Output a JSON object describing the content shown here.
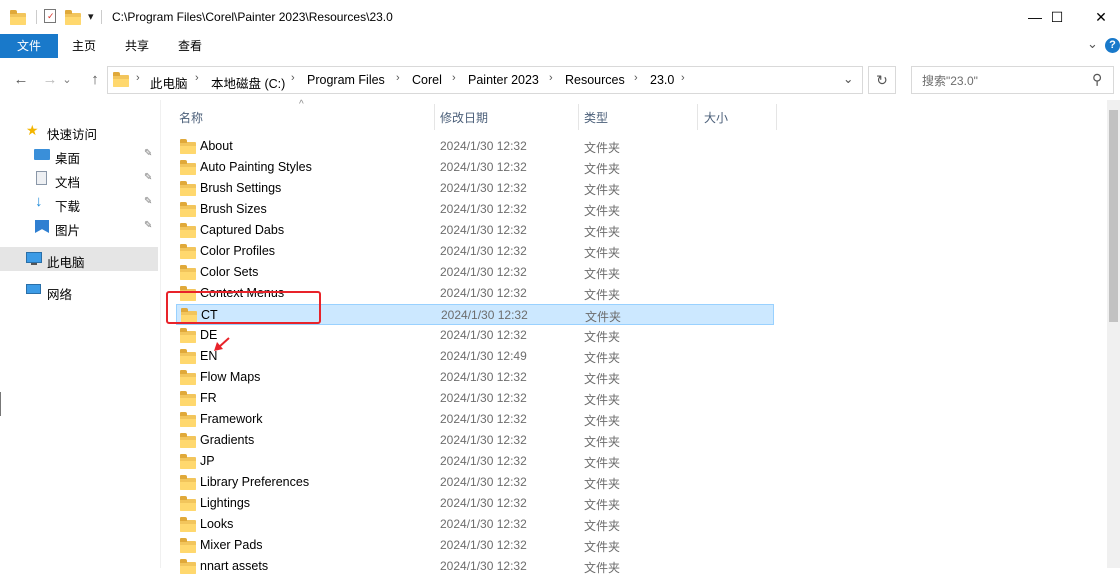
{
  "window": {
    "title_path": "C:\\Program Files\\Corel\\Painter 2023\\Resources\\23.0",
    "qat_dropdown": "▾",
    "minimize": "—",
    "maximize": "☐",
    "close": "✕"
  },
  "ribbon": {
    "tabs": [
      "文件",
      "主页",
      "共享",
      "查看"
    ],
    "expand_chevron": "⌄",
    "help": "?"
  },
  "address": {
    "back": "←",
    "forward": "→",
    "recent": "⌄",
    "up": "↑",
    "crumbs": [
      "此电脑",
      "本地磁盘 (C:)",
      "Program Files",
      "Corel",
      "Painter 2023",
      "Resources",
      "23.0"
    ],
    "dropdown": "⌄",
    "refresh": "↻"
  },
  "search": {
    "placeholder": "搜索\"23.0\"",
    "icon": "⚲"
  },
  "sidebar": {
    "quick_access": "快速访问",
    "quick_items": [
      "桌面",
      "文档",
      "下载",
      "图片"
    ],
    "this_pc": "此电脑",
    "network": "网络",
    "pin_glyph": "📌"
  },
  "columns": {
    "name": "名称",
    "date": "修改日期",
    "type": "类型",
    "size": "大小",
    "sort_caret": "^"
  },
  "files": [
    {
      "name": "About",
      "date": "2024/1/30 12:32",
      "type": "文件夹"
    },
    {
      "name": "Auto Painting Styles",
      "date": "2024/1/30 12:32",
      "type": "文件夹"
    },
    {
      "name": "Brush Settings",
      "date": "2024/1/30 12:32",
      "type": "文件夹"
    },
    {
      "name": "Brush Sizes",
      "date": "2024/1/30 12:32",
      "type": "文件夹"
    },
    {
      "name": "Captured Dabs",
      "date": "2024/1/30 12:32",
      "type": "文件夹"
    },
    {
      "name": "Color Profiles",
      "date": "2024/1/30 12:32",
      "type": "文件夹"
    },
    {
      "name": "Color Sets",
      "date": "2024/1/30 12:32",
      "type": "文件夹"
    },
    {
      "name": "Context Menus",
      "date": "2024/1/30 12:32",
      "type": "文件夹"
    },
    {
      "name": "CT",
      "date": "2024/1/30 12:32",
      "type": "文件夹",
      "selected": true
    },
    {
      "name": "DE",
      "date": "2024/1/30 12:32",
      "type": "文件夹"
    },
    {
      "name": "EN",
      "date": "2024/1/30 12:49",
      "type": "文件夹"
    },
    {
      "name": "Flow Maps",
      "date": "2024/1/30 12:32",
      "type": "文件夹"
    },
    {
      "name": "FR",
      "date": "2024/1/30 12:32",
      "type": "文件夹"
    },
    {
      "name": "Framework",
      "date": "2024/1/30 12:32",
      "type": "文件夹"
    },
    {
      "name": "Gradients",
      "date": "2024/1/30 12:32",
      "type": "文件夹"
    },
    {
      "name": "JP",
      "date": "2024/1/30 12:32",
      "type": "文件夹"
    },
    {
      "name": "Library Preferences",
      "date": "2024/1/30 12:32",
      "type": "文件夹"
    },
    {
      "name": "Lightings",
      "date": "2024/1/30 12:32",
      "type": "文件夹"
    },
    {
      "name": "Looks",
      "date": "2024/1/30 12:32",
      "type": "文件夹"
    },
    {
      "name": "Mixer Pads",
      "date": "2024/1/30 12:32",
      "type": "文件夹"
    },
    {
      "name": "nnart assets",
      "date": "2024/1/30 12:32",
      "type": "文件夹"
    }
  ],
  "colors": {
    "accent": "#1979ca",
    "selection": "#cce8ff",
    "annotation": "#e8232a"
  }
}
